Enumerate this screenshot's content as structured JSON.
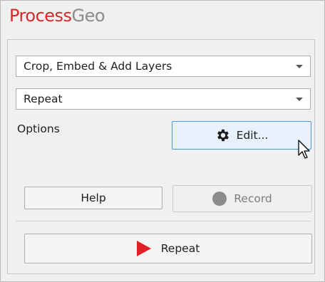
{
  "app": {
    "brand_part1": "Process",
    "brand_part2": "Geo",
    "brand_color1": "#d42a2a",
    "brand_color2": "#8b8b8b"
  },
  "combos": {
    "preset": {
      "value": "Crop, Embed & Add Layers",
      "icon": "chevron-down-icon"
    },
    "mode": {
      "value": "Repeat",
      "icon": "chevron-down-icon"
    }
  },
  "options": {
    "label": "Options",
    "edit_label": "Edit...",
    "edit_icon": "gear-icon"
  },
  "actions": {
    "help_label": "Help",
    "record_label": "Record",
    "record_state": "disabled",
    "record_icon": "record-dot-icon",
    "repeat_label": "Repeat",
    "repeat_icon": "play-icon",
    "accent_play": "#e01f26"
  }
}
